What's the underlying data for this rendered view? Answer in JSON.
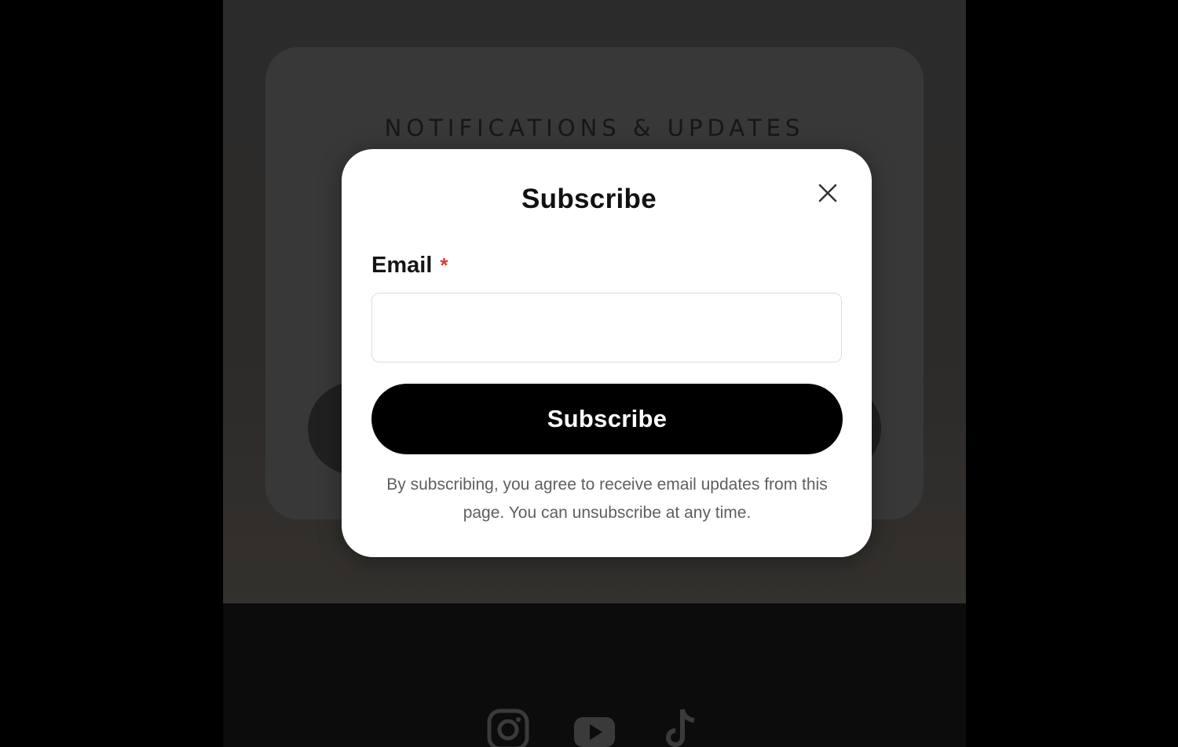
{
  "background_page": {
    "section_heading": "NOTIFICATIONS & UPDATES",
    "social_links": [
      {
        "icon": "instagram-icon"
      },
      {
        "icon": "youtube-icon"
      },
      {
        "icon": "tiktok-icon"
      }
    ]
  },
  "modal": {
    "title": "Subscribe",
    "close_icon": "close-icon",
    "email_label": "Email",
    "required_marker": "*",
    "email_value": "",
    "submit_label": "Subscribe",
    "disclaimer": "By subscribing, you agree to receive email updates from this page. You can unsubscribe at any time."
  },
  "colors": {
    "overlay_backdrop": "#000000",
    "modal_background": "#ffffff",
    "button_background": "#000000",
    "button_text": "#ffffff",
    "required_star": "#e5373a",
    "disclaimer_text": "#5f5f5f"
  }
}
